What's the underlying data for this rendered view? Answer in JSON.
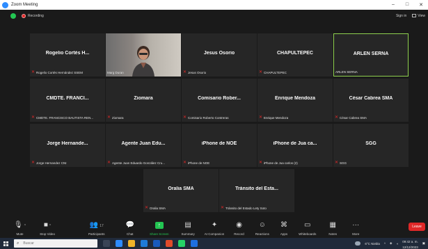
{
  "window": {
    "title": "Zoom Meeting",
    "controls": [
      "–",
      "□",
      "✕"
    ]
  },
  "infobar": {
    "recording_label": "Recording",
    "sign_in": "Sign in",
    "view": "View"
  },
  "tiles": [
    {
      "name": "Rogelio Cortés H...",
      "caption": "Rogelio Cortés Hernández SSEM",
      "muted": true
    },
    {
      "name": "",
      "caption": "Marg Duran",
      "muted": false,
      "video": true
    },
    {
      "name": "Jesus Osorio",
      "caption": "Jesus Osorio",
      "muted": true
    },
    {
      "name": "CHAPULTEPEC",
      "caption": "CHAPULTEPEC",
      "muted": true
    },
    {
      "name": "ARLEN SERNA",
      "caption": "ARLEN SERNA",
      "muted": false,
      "active": true
    },
    {
      "name": "CMDTE. FRANCI...",
      "caption": "CMDTE. FRANCISCO BAUTISTA REN...",
      "muted": true
    },
    {
      "name": "Ziomara",
      "caption": "Ziomara",
      "muted": true
    },
    {
      "name": "Comisario Rober...",
      "caption": "Comisario Roberto Contreras",
      "muted": true
    },
    {
      "name": "Enrique Mendoza",
      "caption": "Enrique Mendoza",
      "muted": true
    },
    {
      "name": "César Cabrea SMA",
      "caption": "César Cabrea SMA",
      "muted": true
    },
    {
      "name": "Jorge Hernande...",
      "caption": "Jorge Hernandez CNI",
      "muted": true
    },
    {
      "name": "Agente Juan Edu...",
      "caption": "Agente Juan Eduardo González Cru...",
      "muted": true
    },
    {
      "name": "iPhone de NOE",
      "caption": "iPhone de NOE",
      "muted": true
    },
    {
      "name": "iPhone de Jua ca...",
      "caption": "iPhone de Jua carlos (2)",
      "muted": true
    },
    {
      "name": "SGG",
      "caption": "SGG",
      "muted": true
    },
    {
      "name": "Oralia SMA",
      "caption": "Oralia SMA",
      "muted": true
    },
    {
      "name": "Tránsito del Esta...",
      "caption": "Tránsito del Estado Lety Soto",
      "muted": true
    }
  ],
  "toolbar": {
    "mute": "Mute",
    "stop_video": "Stop Video",
    "participants": "Participants",
    "participants_count": "17",
    "chat": "Chat",
    "share_screen": "Share Screen",
    "summary": "Summary",
    "ai_companion": "AI Companion",
    "record": "Record",
    "reactions": "Reactions",
    "apps": "Apps",
    "whiteboards": "Whiteboards",
    "notes": "Notes",
    "more": "More",
    "leave": "Leave"
  },
  "taskbar": {
    "search_placeholder": "Buscar",
    "weather": "6°C  Niebla",
    "time": "09:42 a. m.",
    "date": "12/12/2023"
  },
  "colors": {
    "accent": "#2d8cff",
    "share": "#23c552",
    "leave": "#e02828",
    "active_border": "#8fd14f",
    "tile": "#262626"
  }
}
